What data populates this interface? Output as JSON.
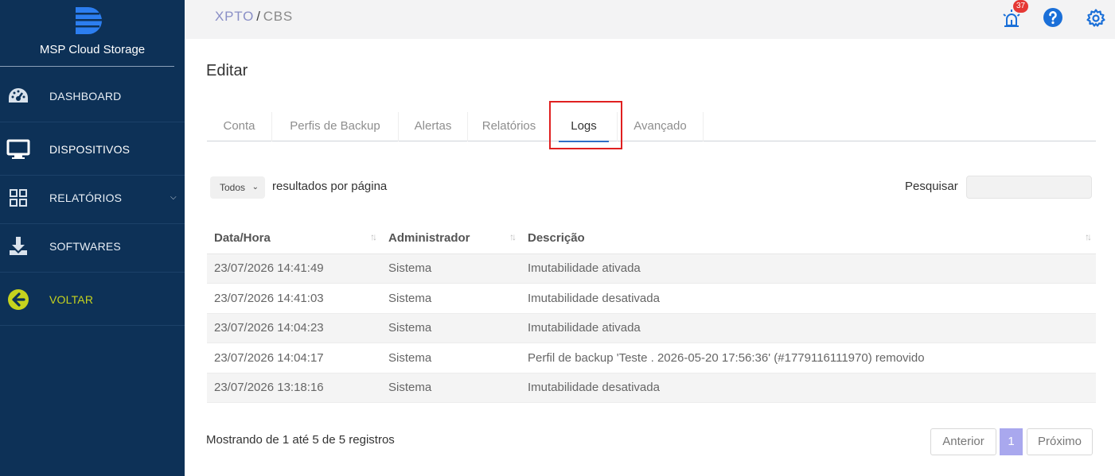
{
  "sidebar": {
    "brand": "MSP Cloud Storage",
    "items": [
      {
        "label": "DASHBOARD",
        "icon": "gauge-icon"
      },
      {
        "label": "DISPOSITIVOS",
        "icon": "monitor-icon"
      },
      {
        "label": "RELATÓRIOS",
        "icon": "grid-icon"
      },
      {
        "label": "SOFTWARES",
        "icon": "download-icon"
      },
      {
        "label": "VOLTAR",
        "icon": "arrow-left-circle-icon"
      }
    ]
  },
  "header": {
    "crumb_1": "XPTO",
    "crumb_sep": "/",
    "crumb_2": "CBS",
    "alerts_count": "37"
  },
  "page": {
    "title": "Editar",
    "tabs": [
      "Conta",
      "Perfis de Backup",
      "Alertas",
      "Relatórios",
      "Logs",
      "Avançado"
    ],
    "active_tab": "Logs"
  },
  "table_controls": {
    "length_value": "Todos",
    "length_label": "resultados por página",
    "search_label": "Pesquisar",
    "search_value": ""
  },
  "table": {
    "headers": [
      "Data/Hora",
      "Administrador",
      "Descrição"
    ],
    "rows": [
      [
        "23/07/2026 14:41:49",
        "Sistema",
        "Imutabilidade ativada"
      ],
      [
        "23/07/2026 14:41:03",
        "Sistema",
        "Imutabilidade desativada"
      ],
      [
        "23/07/2026 14:04:23",
        "Sistema",
        "Imutabilidade ativada"
      ],
      [
        "23/07/2026 14:04:17",
        "Sistema",
        "Perfil de backup 'Teste . 2026-05-20 17:56:36' (#1779116111970) removido"
      ],
      [
        "23/07/2026 13:18:16",
        "Sistema",
        "Imutabilidade desativada"
      ]
    ]
  },
  "footer": {
    "info": "Mostrando de 1 até 5 de 5 registros",
    "prev": "Anterior",
    "page": "1",
    "next": "Próximo"
  },
  "colors": {
    "sidebar_bg": "#0d3157",
    "accent_blue": "#1a6fd8",
    "voltar": "#c6d31e",
    "highlight_border": "#e02020",
    "badge": "#e53935"
  }
}
